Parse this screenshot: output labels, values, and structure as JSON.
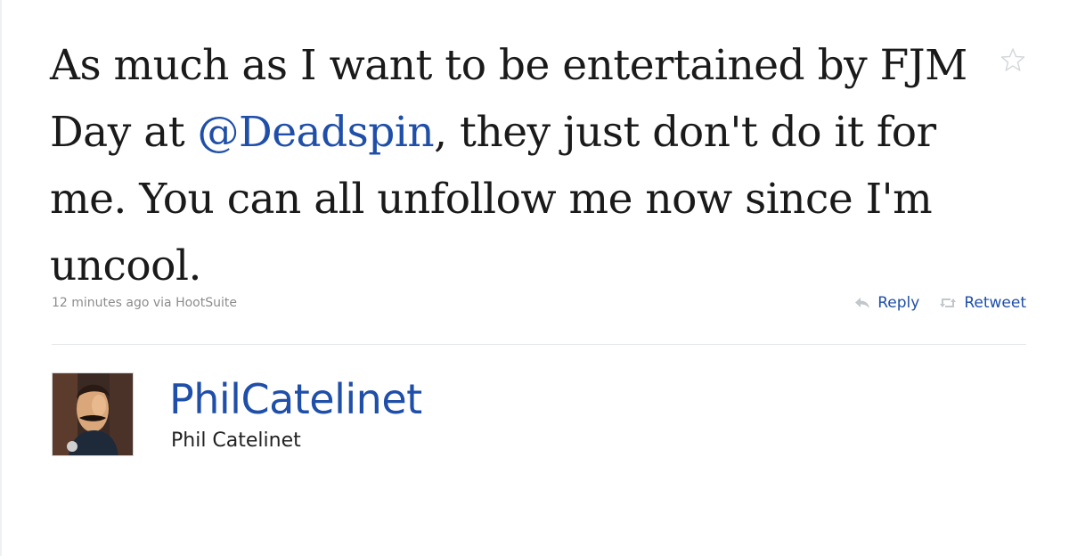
{
  "tweet": {
    "text_before_mention": "As much as I want to be entertained by FJM Day at ",
    "mention": "@Deadspin",
    "text_after_mention": ", they just don't do it for me. You can all unfollow me now since I'm uncool.",
    "timestamp": "12 minutes ago via HootSuite",
    "actions": {
      "reply_label": "Reply",
      "retweet_label": "Retweet"
    },
    "favorite_icon": "star-icon"
  },
  "author": {
    "screen_name": "PhilCatelinet",
    "full_name": "Phil Catelinet",
    "avatar_icon": "avatar-puppet-image"
  },
  "colors": {
    "link": "#1f4fa8",
    "text": "#1a1a1a",
    "meta": "#8c8c8c",
    "divider": "#e3e6e8"
  }
}
